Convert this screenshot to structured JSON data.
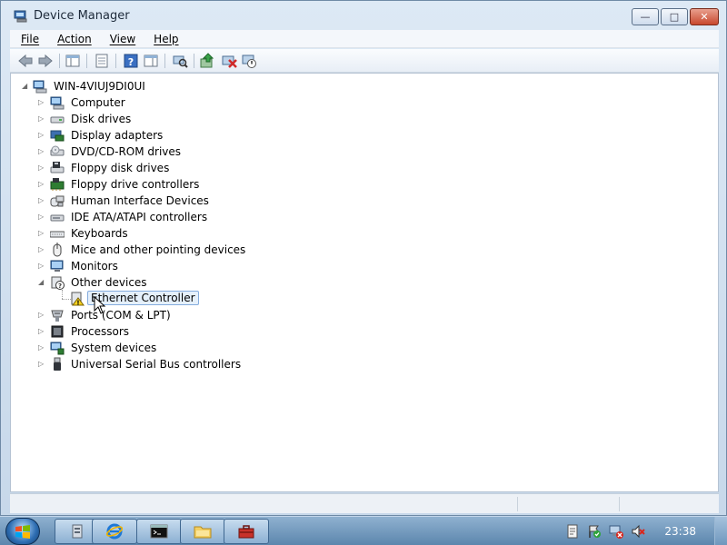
{
  "window": {
    "title": "Device Manager"
  },
  "menu": {
    "file": "File",
    "action": "Action",
    "view": "View",
    "help": "Help"
  },
  "tree": {
    "root": "WIN-4VIUJ9DI0UI",
    "categories": [
      {
        "label": "Computer",
        "icon": "computer-icon"
      },
      {
        "label": "Disk drives",
        "icon": "disk-drive-icon"
      },
      {
        "label": "Display adapters",
        "icon": "display-adapter-icon"
      },
      {
        "label": "DVD/CD-ROM drives",
        "icon": "dvd-icon"
      },
      {
        "label": "Floppy disk drives",
        "icon": "floppy-icon"
      },
      {
        "label": "Floppy drive controllers",
        "icon": "floppy-controller-icon"
      },
      {
        "label": "Human Interface Devices",
        "icon": "hid-icon"
      },
      {
        "label": "IDE ATA/ATAPI controllers",
        "icon": "ide-icon"
      },
      {
        "label": "Keyboards",
        "icon": "keyboard-icon"
      },
      {
        "label": "Mice and other pointing devices",
        "icon": "mouse-icon"
      },
      {
        "label": "Monitors",
        "icon": "monitor-icon"
      },
      {
        "label": "Other devices",
        "icon": "unknown-device-icon",
        "expanded": true
      },
      {
        "label": "Ethernet Controller",
        "icon": "warning-device-icon",
        "child": true,
        "selected": true
      },
      {
        "label": "Ports (COM & LPT)",
        "icon": "port-icon"
      },
      {
        "label": "Processors",
        "icon": "processor-icon"
      },
      {
        "label": "System devices",
        "icon": "system-device-icon"
      },
      {
        "label": "Universal Serial Bus controllers",
        "icon": "usb-icon"
      }
    ]
  },
  "taskbar": {
    "clock": "23:38"
  },
  "colors": {
    "accent": "#2d6db2",
    "selection": "#e5f0fb",
    "selection_border": "#84acdd",
    "close_button": "#c8482e"
  }
}
